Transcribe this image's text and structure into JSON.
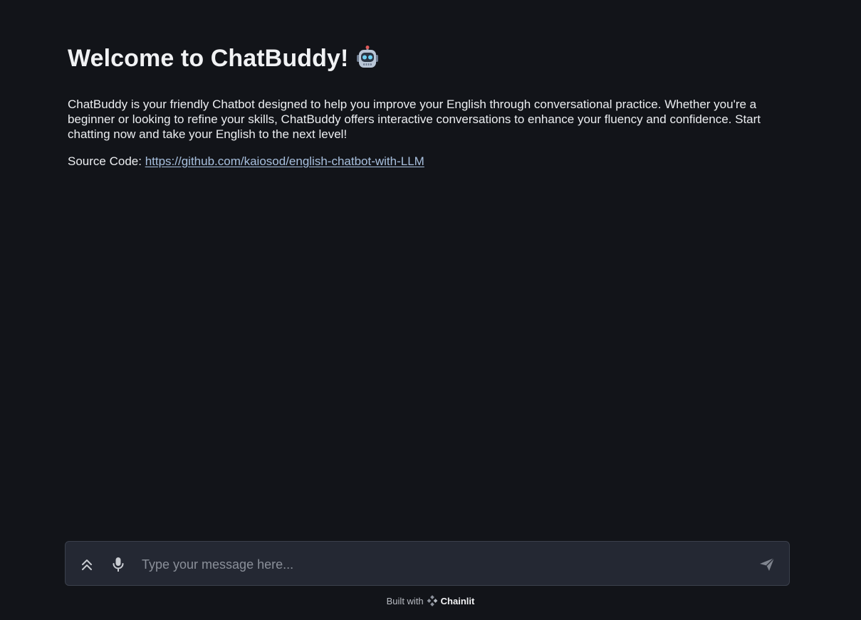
{
  "welcome": {
    "title": "Welcome to ChatBuddy!",
    "title_emoji_icon": "robot-icon",
    "intro": "ChatBuddy is your friendly Chatbot designed to help you improve your English through conversational practice. Whether you're a beginner or looking to refine your skills, ChatBuddy offers interactive conversations to enhance your fluency and confidence. Start chatting now and take your English to the next level!",
    "source_label": "Source Code:",
    "source_link": "https://github.com/kaiosod/english-chatbot-with-LLM"
  },
  "composer": {
    "placeholder": "Type your message here...",
    "value": "",
    "icons": [
      "chevrons-up-icon",
      "microphone-icon",
      "send-icon"
    ]
  },
  "footer": {
    "built_with": "Built with",
    "brand": "Chainlit",
    "brand_icon": "chainlit-logo-icon"
  },
  "colors": {
    "background": "#121419",
    "composer_bg": "#242833",
    "link": "#a8c0de"
  }
}
